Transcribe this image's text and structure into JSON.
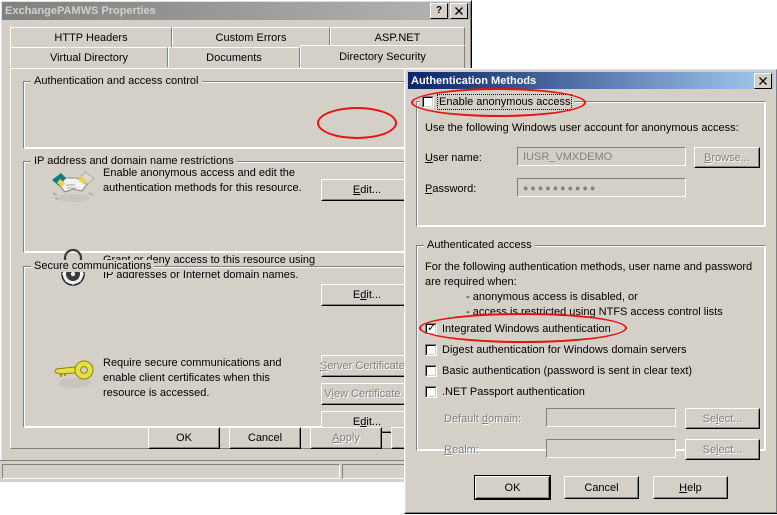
{
  "properties_dialog": {
    "title": "ExchangePAMWS Properties",
    "titlebar_buttons": {
      "help": "?",
      "close": "✕"
    },
    "tabs_row1": [
      {
        "label": "HTTP Headers",
        "selected": false
      },
      {
        "label": "Custom Errors",
        "selected": false
      },
      {
        "label": "ASP.NET",
        "selected": false
      }
    ],
    "tabs_row2": [
      {
        "label": "Virtual Directory",
        "selected": false
      },
      {
        "label": "Documents",
        "selected": false
      },
      {
        "label": "Directory Security",
        "selected": true
      }
    ],
    "groups": {
      "auth": {
        "title": "Authentication and access control",
        "icon": "handshake-icon",
        "line1": "Enable anonymous access and edit the",
        "line2": "authentication methods for this resource.",
        "edit_label": "Edit..."
      },
      "ip": {
        "title": "IP address and domain name restrictions",
        "icon": "padlock-icon",
        "line1": "Grant or deny access to this resource using",
        "line2": "IP addresses or Internet domain names.",
        "edit_label": "Edit..."
      },
      "secure": {
        "title": "Secure communications",
        "icon": "key-icon",
        "line1": "Require secure communications and",
        "line2": "enable client certificates when this",
        "line3": "resource is accessed.",
        "server_cert_label": "Server Certificate...",
        "view_cert_label": "View Certificate...",
        "edit_label": "Edit..."
      }
    },
    "buttons": {
      "ok": "OK",
      "cancel": "Cancel",
      "apply": "Apply"
    }
  },
  "auth_methods_dialog": {
    "title": "Authentication Methods",
    "close_label": "✕",
    "anonymous": {
      "checkbox_label": "Enable anonymous access",
      "checked": false,
      "description": "Use the following Windows user account for anonymous access:",
      "username_label": "User name:",
      "username_value": "IUSR_VMXDEMO",
      "browse_label": "Browse...",
      "password_label": "Password:",
      "password_value": "●●●●●●●●●●"
    },
    "authenticated": {
      "title": "Authenticated access",
      "desc_line1": "For the following authentication methods, user name and password",
      "desc_line2": "are required when:",
      "desc_line3": "- anonymous access is disabled, or",
      "desc_line4": "- access is restricted using NTFS access control lists",
      "methods": [
        {
          "label": "Integrated Windows authentication",
          "checked": true
        },
        {
          "label": "Digest authentication for Windows domain servers",
          "checked": false
        },
        {
          "label": "Basic authentication (password is sent in clear text)",
          "checked": false
        },
        {
          "label": ".NET Passport authentication",
          "checked": false
        }
      ],
      "default_domain_label": "Default domain:",
      "default_domain_value": "",
      "default_domain_select": "Select...",
      "realm_label": "Realm:",
      "realm_value": "",
      "realm_select": "Select..."
    },
    "buttons": {
      "ok": "OK",
      "cancel": "Cancel",
      "help": "Help"
    }
  },
  "annotations": {
    "color": "#e8110f",
    "marks": [
      "ellipse-edit-button",
      "ellipse-enable-anonymous-access",
      "ellipse-integrated-windows-authentication"
    ]
  }
}
